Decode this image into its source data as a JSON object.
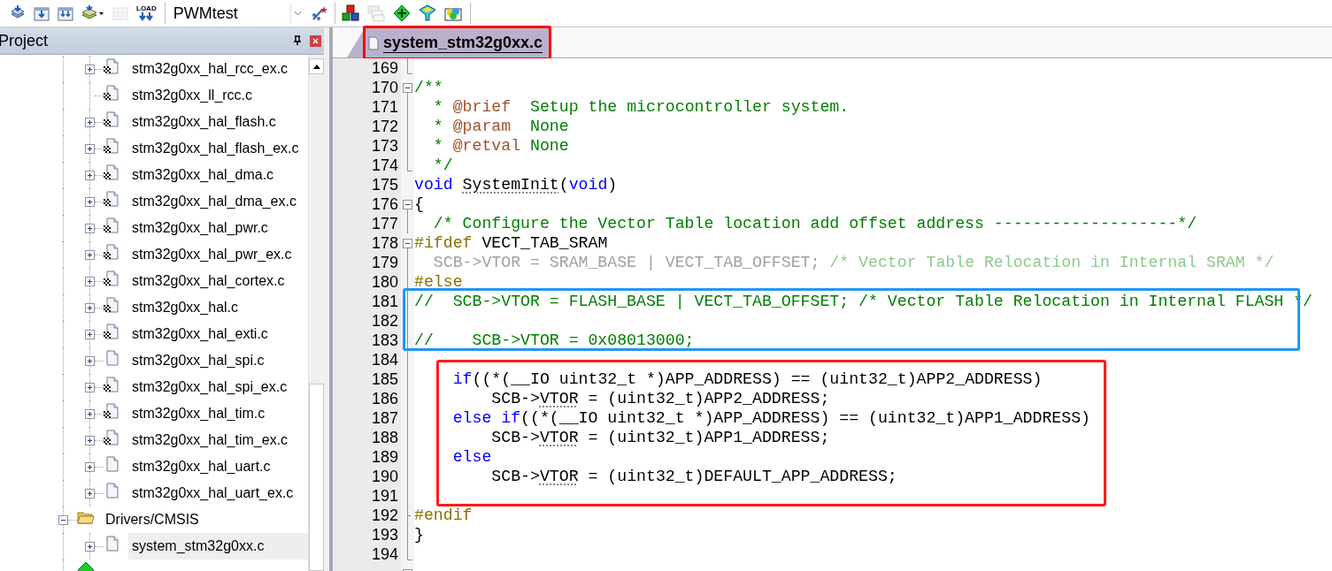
{
  "toolbar": {
    "buttons": [
      {
        "kind": "stack-download",
        "disabled": false
      },
      {
        "kind": "window-download",
        "disabled": false
      },
      {
        "kind": "window-download-all",
        "disabled": false
      },
      {
        "kind": "layers-menu",
        "disabled": false
      },
      {
        "kind": "batch",
        "disabled": true
      },
      {
        "kind": "load",
        "label": "LOAD",
        "disabled": false
      }
    ],
    "target": "PWMtest",
    "tools": [
      {
        "kind": "wand",
        "disabled": false
      },
      {
        "kind": "blocks",
        "disabled": false
      },
      {
        "kind": "windows",
        "disabled": true
      },
      {
        "kind": "diamond",
        "disabled": false
      },
      {
        "kind": "funnel",
        "disabled": false
      },
      {
        "kind": "palette",
        "disabled": false
      }
    ]
  },
  "project_panel": {
    "title": "Project",
    "tree": [
      {
        "children": [
          {
            "label": "stm32g0xx_hal_rcc_ex.c",
            "kind": "file",
            "badge": true,
            "expandable": true,
            "expanded": false,
            "selected": false
          },
          {
            "label": "stm32g0xx_ll_rcc.c",
            "kind": "file",
            "badge": true,
            "expandable": false,
            "expanded": false,
            "selected": false
          },
          {
            "label": "stm32g0xx_hal_flash.c",
            "kind": "file",
            "badge": true,
            "expandable": true,
            "expanded": false,
            "selected": false
          },
          {
            "label": "stm32g0xx_hal_flash_ex.c",
            "kind": "file",
            "badge": true,
            "expandable": true,
            "expanded": false,
            "selected": false
          },
          {
            "label": "stm32g0xx_hal_dma.c",
            "kind": "file",
            "badge": true,
            "expandable": true,
            "expanded": false,
            "selected": false
          },
          {
            "label": "stm32g0xx_hal_dma_ex.c",
            "kind": "file",
            "badge": true,
            "expandable": true,
            "expanded": false,
            "selected": false
          },
          {
            "label": "stm32g0xx_hal_pwr.c",
            "kind": "file",
            "badge": true,
            "expandable": true,
            "expanded": false,
            "selected": false
          },
          {
            "label": "stm32g0xx_hal_pwr_ex.c",
            "kind": "file",
            "badge": true,
            "expandable": true,
            "expanded": false,
            "selected": false
          },
          {
            "label": "stm32g0xx_hal_cortex.c",
            "kind": "file",
            "badge": true,
            "expandable": true,
            "expanded": false,
            "selected": false
          },
          {
            "label": "stm32g0xx_hal.c",
            "kind": "file",
            "badge": true,
            "expandable": true,
            "expanded": false,
            "selected": false
          },
          {
            "label": "stm32g0xx_hal_exti.c",
            "kind": "file",
            "badge": true,
            "expandable": true,
            "expanded": false,
            "selected": false
          },
          {
            "label": "stm32g0xx_hal_spi.c",
            "kind": "file",
            "badge": false,
            "expandable": true,
            "expanded": false,
            "selected": false
          },
          {
            "label": "stm32g0xx_hal_spi_ex.c",
            "kind": "file",
            "badge": true,
            "expandable": true,
            "expanded": false,
            "selected": false
          },
          {
            "label": "stm32g0xx_hal_tim.c",
            "kind": "file",
            "badge": true,
            "expandable": true,
            "expanded": false,
            "selected": false
          },
          {
            "label": "stm32g0xx_hal_tim_ex.c",
            "kind": "file",
            "badge": true,
            "expandable": true,
            "expanded": false,
            "selected": false
          },
          {
            "label": "stm32g0xx_hal_uart.c",
            "kind": "file",
            "badge": false,
            "expandable": true,
            "expanded": false,
            "selected": false
          },
          {
            "label": "stm32g0xx_hal_uart_ex.c",
            "kind": "file",
            "badge": false,
            "expandable": true,
            "expanded": false,
            "selected": false
          }
        ]
      },
      {
        "label": "Drivers/CMSIS",
        "kind": "folder",
        "expandable": true,
        "expanded": true,
        "selected": false,
        "children": [
          {
            "label": "system_stm32g0xx.c",
            "kind": "file",
            "badge": false,
            "expandable": true,
            "expanded": false,
            "selected": true
          }
        ]
      },
      {
        "kind": "component"
      }
    ]
  },
  "editor": {
    "tabs": [
      {
        "label": "system_stm32g0xx.c",
        "selected": true,
        "color": "#ff0000"
      }
    ],
    "code_blocks": [
      {
        "lines": [
          {
            "number": "169",
            "kind": "fold-end"
          },
          {
            "number": "170",
            "kind": "fold-start",
            "segments": [
              {
                "kind": "comment",
                "text": "/**"
              }
            ]
          },
          {
            "number": "171",
            "kind": "fold-body",
            "segments": [
              {
                "kind": "comment",
                "text": "  * "
              },
              {
                "kind": "doctag",
                "text": "@brief"
              },
              {
                "kind": "comment",
                "text": "  Setup the microcontroller system."
              }
            ]
          },
          {
            "number": "172",
            "kind": "fold-body",
            "segments": [
              {
                "kind": "comment",
                "text": "  * "
              },
              {
                "kind": "doctag",
                "text": "@param"
              },
              {
                "kind": "comment",
                "text": "  None"
              }
            ]
          },
          {
            "number": "173",
            "kind": "fold-body",
            "segments": [
              {
                "kind": "comment",
                "text": "  * "
              },
              {
                "kind": "doctag",
                "text": "@retval"
              },
              {
                "kind": "comment",
                "text": " None"
              }
            ]
          },
          {
            "number": "174",
            "kind": "fold-end",
            "segments": [
              {
                "kind": "comment",
                "text": "  */"
              }
            ]
          },
          {
            "number": "175",
            "kind": "plain",
            "segments": [
              {
                "kind": "keyword",
                "text": "void "
              },
              {
                "kind": "symbol",
                "text": "SystemInit"
              },
              {
                "kind": "plain",
                "text": "("
              },
              {
                "kind": "keyword",
                "text": "void"
              },
              {
                "kind": "plain",
                "text": ")"
              }
            ]
          },
          {
            "number": "176",
            "kind": "fold-start",
            "segments": [
              {
                "kind": "plain",
                "text": "{"
              }
            ]
          },
          {
            "number": "177",
            "kind": "fold-body",
            "segments": [
              {
                "kind": "comment",
                "text": "  /* Configure the Vector Table location add offset address -------------------*/"
              }
            ]
          },
          {
            "number": "178",
            "kind": "fold-start",
            "segments": [
              {
                "kind": "preproc",
                "text": "#ifdef"
              },
              {
                "kind": "plain",
                "text": " VECT_TAB_SRAM"
              }
            ]
          },
          {
            "number": "179",
            "kind": "fold-body",
            "segments": [
              {
                "kind": "inactive",
                "text": "  SCB->VTOR = SRAM_BASE | VECT_TAB_OFFSET; "
              },
              {
                "kind": "inactive-comment",
                "text": "/* Vector Table Relocation in Internal SRAM */"
              }
            ]
          },
          {
            "number": "180",
            "kind": "fold-body",
            "segments": [
              {
                "kind": "preproc",
                "text": "#else"
              }
            ]
          }
        ]
      },
      {
        "color": "#2196f3",
        "lines": [
          {
            "number": "181",
            "kind": "fold-body",
            "segments": [
              {
                "kind": "comment",
                "text": "//  SCB->VTOR = FLASH_BASE | VECT_TAB_OFFSET; /* Vector Table Relocation in Internal FLASH */"
              }
            ]
          },
          {
            "number": "182",
            "kind": "fold-body"
          },
          {
            "number": "183",
            "kind": "fold-body",
            "segments": [
              {
                "kind": "comment",
                "text": "//    SCB->VTOR = 0x08013000;"
              }
            ]
          }
        ]
      },
      {
        "lines": [
          {
            "number": "184",
            "kind": "fold-body"
          }
        ]
      },
      {
        "color": "#ff1a1a",
        "lines": [
          {
            "number": "185",
            "kind": "fold-body",
            "segments": [
              {
                "kind": "keyword",
                "text": "    if"
              },
              {
                "kind": "plain",
                "text": "((*(__IO uint32_t *)APP_ADDRESS) == (uint32_t)APP2_ADDRESS)"
              }
            ]
          },
          {
            "number": "186",
            "kind": "fold-body",
            "segments": [
              {
                "kind": "plain",
                "text": "        SCB->"
              },
              {
                "kind": "symbol",
                "text": "VTOR"
              },
              {
                "kind": "plain",
                "text": " = (uint32_t)APP2_ADDRESS;"
              }
            ]
          },
          {
            "number": "187",
            "kind": "fold-body",
            "segments": [
              {
                "kind": "keyword",
                "text": "    else if"
              },
              {
                "kind": "plain",
                "text": "((*(__IO uint32_t *)APP_ADDRESS) == (uint32_t)APP1_ADDRESS)"
              }
            ]
          },
          {
            "number": "188",
            "kind": "fold-body",
            "segments": [
              {
                "kind": "plain",
                "text": "        SCB->"
              },
              {
                "kind": "symbol",
                "text": "VTOR"
              },
              {
                "kind": "plain",
                "text": " = (uint32_t)APP1_ADDRESS;"
              }
            ]
          },
          {
            "number": "189",
            "kind": "fold-body",
            "segments": [
              {
                "kind": "keyword",
                "text": "    else"
              }
            ]
          },
          {
            "number": "190",
            "kind": "fold-body",
            "segments": [
              {
                "kind": "plain",
                "text": "        SCB->"
              },
              {
                "kind": "symbol",
                "text": "VTOR"
              },
              {
                "kind": "plain",
                "text": " = (uint32_t)DEFAULT_APP_ADDRESS;"
              }
            ]
          },
          {
            "number": "191",
            "kind": "fold-body"
          }
        ]
      },
      {
        "lines": [
          {
            "number": "192",
            "kind": "fold-branch",
            "segments": [
              {
                "kind": "preproc",
                "text": "#endif"
              }
            ]
          },
          {
            "number": "193",
            "kind": "fold-body",
            "segments": [
              {
                "kind": "plain",
                "text": "}"
              }
            ]
          },
          {
            "number": "194",
            "kind": "fold-end"
          },
          {
            "kind": "fold-start"
          }
        ]
      }
    ]
  }
}
